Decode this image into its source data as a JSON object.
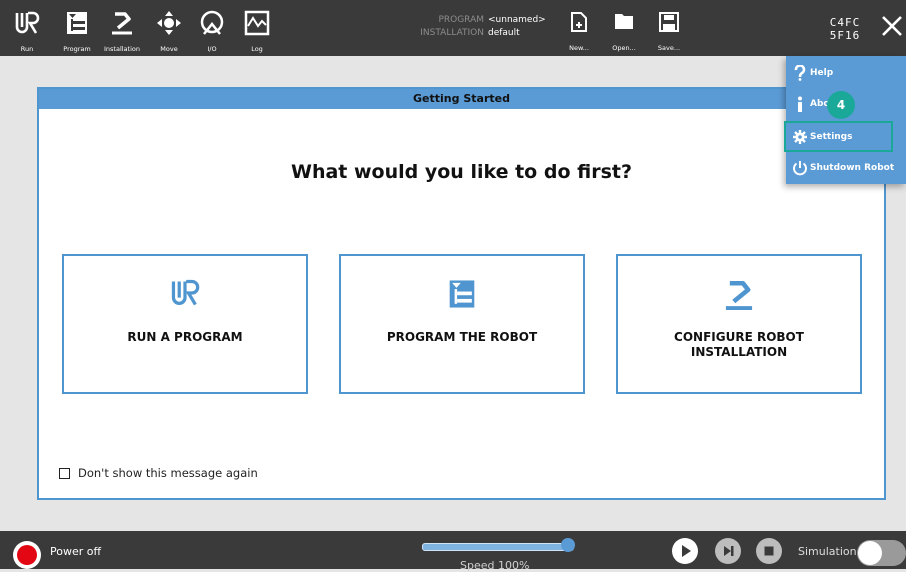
{
  "nav": [
    {
      "label": "Run",
      "icon": "ur-logo-icon"
    },
    {
      "label": "Program",
      "icon": "program-icon"
    },
    {
      "label": "Installation",
      "icon": "robot-arm-icon"
    },
    {
      "label": "Move",
      "icon": "move-arrows-icon"
    },
    {
      "label": "I/O",
      "icon": "io-icon"
    },
    {
      "label": "Log",
      "icon": "log-graph-icon"
    }
  ],
  "program_info": {
    "program_key": "PROGRAM",
    "program_value": "<unnamed>",
    "installation_key": "INSTALLATION",
    "installation_value": "default"
  },
  "file_buttons": {
    "new": "New...",
    "open": "Open...",
    "save": "Save..."
  },
  "robot_id": {
    "line1": "C4FC",
    "line2": "5F16"
  },
  "dialog": {
    "title": "Getting Started",
    "question": "What would you like to do first?",
    "options": [
      {
        "label": "RUN A PROGRAM"
      },
      {
        "label": "PROGRAM THE ROBOT"
      },
      {
        "label": "CONFIGURE ROBOT INSTALLATION"
      }
    ],
    "dont_show": "Don't show this message again"
  },
  "menu": {
    "items": [
      {
        "label": "Help",
        "icon": "help-icon"
      },
      {
        "label": "Abo",
        "icon": "info-icon"
      },
      {
        "label": "Settings",
        "icon": "gear-icon"
      },
      {
        "label": "Shutdown Robot",
        "icon": "power-icon"
      }
    ],
    "badge": "4"
  },
  "bottom": {
    "power_label": "Power off",
    "speed_label": "Speed 100%",
    "speed_value": 1.0,
    "simulation_label": "Simulation"
  },
  "colors": {
    "accent": "#5b9bd5",
    "topbar": "#3a3a3a",
    "highlight": "#1aa899",
    "power": "#e30613"
  }
}
